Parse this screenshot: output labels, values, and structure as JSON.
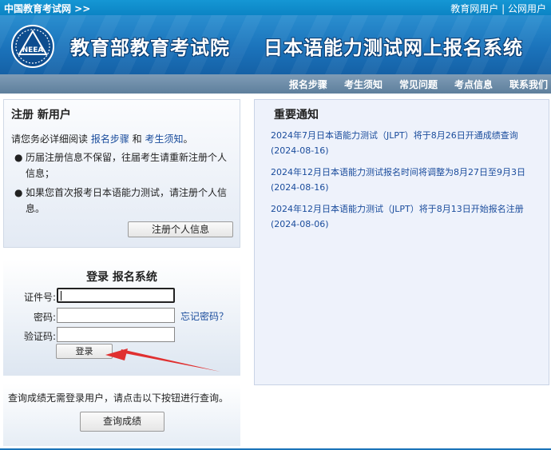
{
  "topbar": {
    "site_link": "中国教育考试网 >>",
    "right_links": [
      "教育网用户",
      "公网用户"
    ],
    "separator": "|"
  },
  "banner": {
    "logo_text": "NEEA",
    "title_part1": "教育部教育考试院",
    "title_part2": "日本语能力测试网上报名系统"
  },
  "nav": {
    "items": [
      "报名步骤",
      "考生须知",
      "常见问题",
      "考点信息",
      "联系我们"
    ]
  },
  "register": {
    "title": "注册 新用户",
    "intro_prefix": "请您务必详细阅读 ",
    "intro_link1": "报名步骤",
    "intro_and": " 和 ",
    "intro_link2": "考生须知",
    "intro_suffix": "。",
    "notes": [
      "历届注册信息不保留，往届考生请重新注册个人信息；",
      "如果您首次报考日本语能力测试，请注册个人信息。"
    ],
    "button": "注册个人信息"
  },
  "login": {
    "title": "登录 报名系统",
    "id_label": "证件号:",
    "id_value": "",
    "password_label": "密码:",
    "password_value": "",
    "forgot_link": "忘记密码？",
    "captcha_label": "验证码:",
    "captcha_value": "",
    "button": "登录"
  },
  "query": {
    "text": "查询成绩无需登录用户，请点击以下按钮进行查询。",
    "button": "查询成绩"
  },
  "news": {
    "title": "重要通知",
    "items": [
      {
        "text": "2024年7月日本语能力测试（JLPT）将于8月26日开通成绩查询",
        "date": "(2024-08-16)"
      },
      {
        "text": "2024年12月日本语能力测试报名时间将调整为8月27日至9月3日",
        "date": "(2024-08-16)"
      },
      {
        "text": "2024年12月日本语能力测试（JLPT）将于8月13日开始报名注册",
        "date": "(2024-08-06)"
      }
    ]
  },
  "colors": {
    "topbar": "#0b84c4",
    "banner": "#1b73bb",
    "nav": "#6a8aa8",
    "link": "#1a4c9c",
    "arrow": "#e03030"
  }
}
